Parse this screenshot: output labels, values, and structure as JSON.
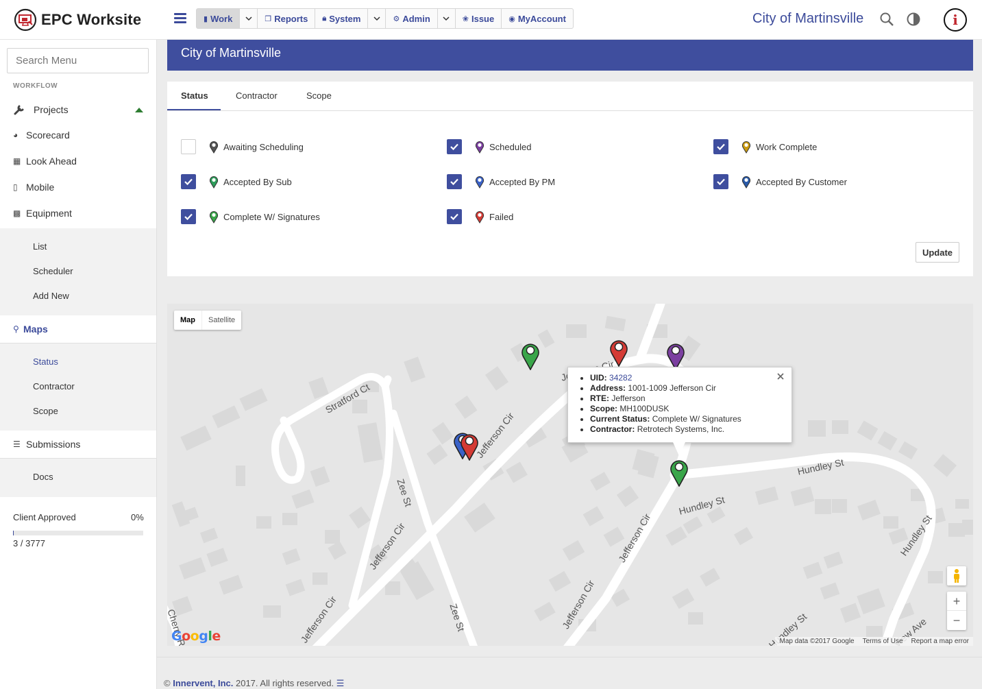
{
  "brand": {
    "name": "EPC Worksite",
    "logo": "epc-monitor-logo"
  },
  "nav": {
    "work": "Work",
    "reports": "Reports",
    "system": "System",
    "admin": "Admin",
    "issue": "Issue",
    "myaccount": "MyAccount"
  },
  "org_title": "City of Martinsville",
  "sidebar": {
    "search_placeholder": "Search Menu",
    "section": "WORKFLOW",
    "projects": "Projects",
    "scorecard": "Scorecard",
    "look_ahead": "Look Ahead",
    "mobile": "Mobile",
    "equipment": "Equipment",
    "equipment_sub": [
      "List",
      "Scheduler",
      "Add New"
    ],
    "maps": "Maps",
    "maps_sub": [
      "Status",
      "Contractor",
      "Scope"
    ],
    "submissions": "Submissions",
    "submissions_sub": [
      "Docs"
    ],
    "client_approved": {
      "label": "Client Approved",
      "percent": "0%",
      "fraction": 0.0008,
      "count": "3 / 3777"
    }
  },
  "panel": {
    "title": "City of Martinsville"
  },
  "tabs": [
    "Status",
    "Contractor",
    "Scope"
  ],
  "statuses": [
    {
      "label": "Awaiting Scheduling",
      "checked": false,
      "color": "#555555"
    },
    {
      "label": "Scheduled",
      "checked": true,
      "color": "#7b3fa0"
    },
    {
      "label": "Work Complete",
      "checked": true,
      "color": "#c99a10"
    },
    {
      "label": "Accepted By Sub",
      "checked": true,
      "color": "#2e9e5b"
    },
    {
      "label": "Accepted By PM",
      "checked": true,
      "color": "#3a62c8"
    },
    {
      "label": "Accepted By Customer",
      "checked": true,
      "color": "#2a5aa8"
    },
    {
      "label": "Complete W/ Signatures",
      "checked": true,
      "color": "#3aa64a"
    },
    {
      "label": "Failed",
      "checked": true,
      "color": "#d43b35"
    }
  ],
  "update_label": "Update",
  "map": {
    "type_map": "Map",
    "type_satellite": "Satellite",
    "streets": [
      "Stratford Ct",
      "Jefferson Cir",
      "Zee St",
      "Jefferson Cir",
      "Jefferson Cir",
      "Zee St",
      "Jefferson Cir",
      "Jefferson Cir",
      "Hundley St",
      "Hundley St",
      "Hundley St",
      "Hundley St",
      "Cherry Rd",
      "View Ave"
    ],
    "partial_street": "Jefferson Cir",
    "infowindow": {
      "uid_label": "UID:",
      "uid": "34282",
      "address_label": "Address:",
      "address": "1001-1009 Jefferson Cir",
      "rte_label": "RTE:",
      "rte": "Jefferson",
      "scope_label": "Scope:",
      "scope": "MH100DUSK",
      "status_label": "Current Status:",
      "status": "Complete W/ Signatures",
      "contractor_label": "Contractor:",
      "contractor": "Retrotech Systems, Inc."
    },
    "google": "Google",
    "attribution": [
      "Map data ©2017 Google",
      "Terms of Use",
      "Report a map error"
    ],
    "zoom_in": "+",
    "zoom_out": "−"
  },
  "footer": {
    "copyright": "©",
    "company": "Innervent, Inc.",
    "rest": "2017. All rights reserved."
  }
}
